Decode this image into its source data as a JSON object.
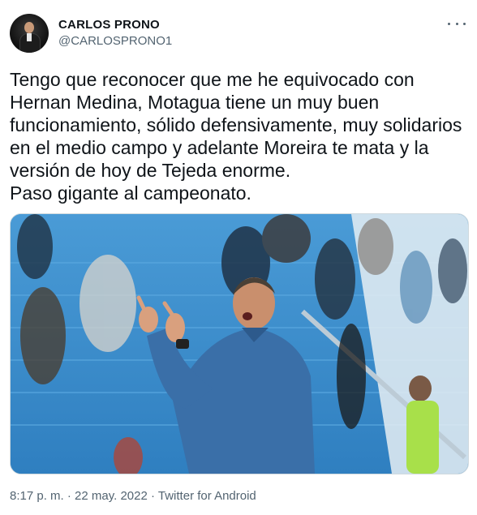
{
  "header": {
    "display_name": "CARLOS PRONO",
    "handle": "@CARLOSPRONO1",
    "more_icon": "more-horizontal-icon"
  },
  "tweet": {
    "text": "Tengo que reconocer que me he equivocado con\nHernan Medina, Motagua tiene un muy buen\nfuncionamiento, sólido defensivamente, muy solidarios\nen el medio campo y adelante Moreira te mata y la\nversión de hoy de Tejeda enorme.\nPaso gigante al campeonato."
  },
  "meta": {
    "time": "8:17 p. m.",
    "separator1": " · ",
    "date": "22 may. 2022",
    "separator2": " · ",
    "source": "Twitter for Android"
  }
}
